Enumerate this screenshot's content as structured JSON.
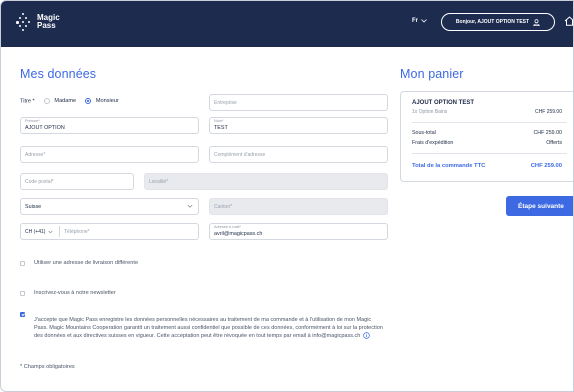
{
  "header": {
    "logo_line1": "Magic",
    "logo_line2": "Pass",
    "language": "Fr",
    "user_button": "Bonjour, AJOUT OPTION TEST"
  },
  "form": {
    "title": "Mes données",
    "titre_label": "Titre *",
    "titre_options": [
      "Madame",
      "Monsieur"
    ],
    "titre_selected": "Monsieur",
    "entreprise_placeholder": "Entreprise",
    "prenom_label": "Prénom*",
    "prenom_value": "AJOUT OPTION",
    "nom_label": "Nom*",
    "nom_value": "TEST",
    "adresse_placeholder": "Adresse*",
    "complement_placeholder": "Complément d'adresse",
    "code_postal_placeholder": "Code postal*",
    "localite_placeholder": "Localité*",
    "pays_value": "Suisse",
    "canton_placeholder": "Canton*",
    "phone_prefix": "CH (+41)",
    "telephone_placeholder": "Téléphone*",
    "email_label": "Adresse e-mail*",
    "email_value": "avril@magicpass.ch",
    "livraison_label": "Utiliser une adresse de livraison différente",
    "livraison_checked": false,
    "newsletter_label": "Inscrivez-vous à notre newsletter",
    "newsletter_checked": false,
    "consent_text": "J'accepte que Magic Pass enregistre les données personnelles nécessaires au traitement de ma commande et à l'utilisation de mon Magic Pass. Magic Mountains Cooperation garantit un traitement aussi confidentiel que possible de ces données, conformément à loi sur la protection des données et aux directives suisses en vigueur. Cette acceptation peut être révoquée en tout temps par email à info@magicpass.ch",
    "consent_checked": true,
    "required_note": "* Champs obligatoires"
  },
  "cart": {
    "title": "Mon panier",
    "product_name": "AJOUT OPTION TEST",
    "product_item": "1x Option Bains",
    "product_price": "CHF 259.00",
    "subtotal_label": "Sous-total",
    "subtotal_value": "CHF 259.00",
    "shipping_label": "Frais d'expédition",
    "shipping_value": "Offerts",
    "total_label": "Total de la commande TTC",
    "total_value": "CHF 259.00",
    "next_button": "Étape suivante"
  },
  "colors": {
    "header_bg": "#1d2b4f",
    "accent": "#3d6ae3",
    "disabled_bg": "#e8eaee"
  },
  "icons": [
    "magic-pass-logo-icon",
    "chevron-down-icon",
    "user-icon",
    "home-icon",
    "info-icon",
    "radio-icon",
    "checkbox-icon"
  ]
}
